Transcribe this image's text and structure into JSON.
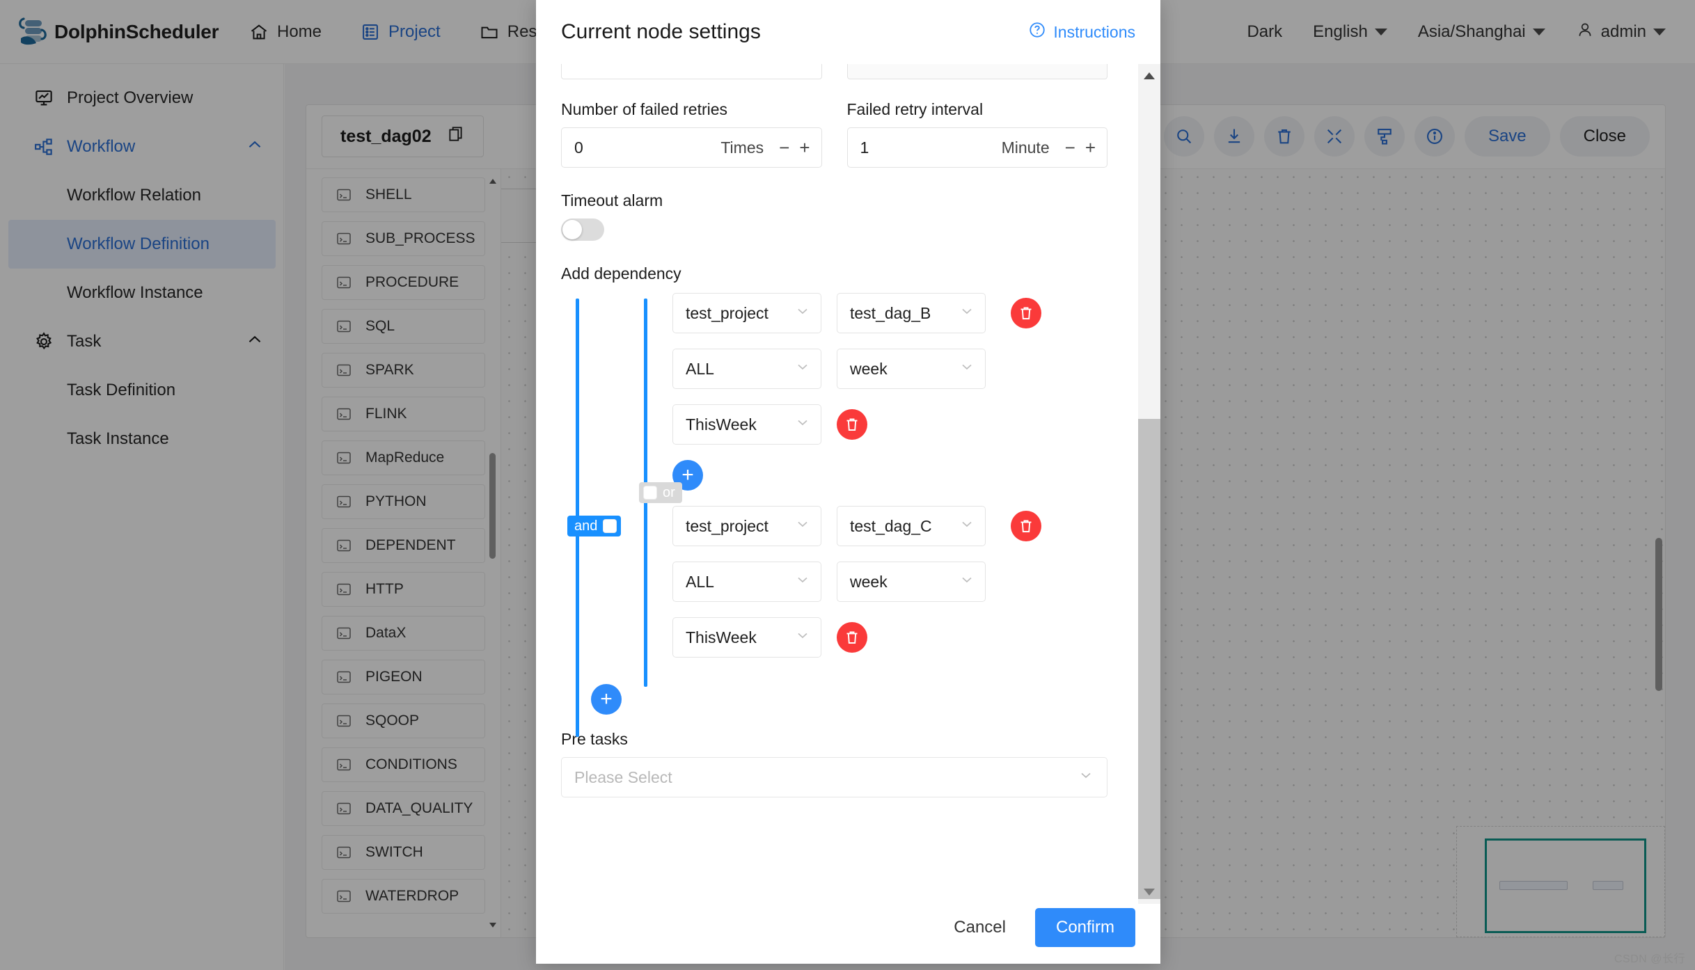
{
  "app": {
    "brand": "DolphinScheduler",
    "nav": [
      {
        "label": "Home",
        "icon": "home-icon",
        "active": false
      },
      {
        "label": "Project",
        "icon": "project-icon",
        "active": true
      },
      {
        "label": "Res",
        "icon": "folder-icon",
        "active": false
      }
    ],
    "top_right": {
      "theme": "Dark",
      "language": "English",
      "timezone": "Asia/Shanghai",
      "user": "admin"
    }
  },
  "sidebar": {
    "items": [
      {
        "label": "Project Overview",
        "icon": "overview-icon",
        "level": "group",
        "state": "normal"
      },
      {
        "label": "Workflow",
        "icon": "workflow-icon",
        "level": "group",
        "state": "expanded"
      },
      {
        "label": "Workflow Relation",
        "icon": "",
        "level": "sub",
        "state": "normal"
      },
      {
        "label": "Workflow Definition",
        "icon": "",
        "level": "sub",
        "state": "selected"
      },
      {
        "label": "Workflow Instance",
        "icon": "",
        "level": "sub",
        "state": "normal"
      },
      {
        "label": "Task",
        "icon": "gear-icon",
        "level": "group",
        "state": "expanded"
      },
      {
        "label": "Task Definition",
        "icon": "",
        "level": "sub",
        "state": "normal"
      },
      {
        "label": "Task Instance",
        "icon": "",
        "level": "sub",
        "state": "normal"
      }
    ]
  },
  "dag": {
    "name": "test_dag02",
    "copy_icon": "copy-icon",
    "toolbar": {
      "icons": [
        "search-icon",
        "download-icon",
        "trash-icon",
        "fullscreen-icon",
        "format-icon",
        "info-icon"
      ],
      "save_label": "Save",
      "close_label": "Close"
    },
    "palette": [
      {
        "label": "SHELL",
        "icon": "shell-icon"
      },
      {
        "label": "SUB_PROCESS",
        "icon": "sub-process-icon"
      },
      {
        "label": "PROCEDURE",
        "icon": "procedure-icon"
      },
      {
        "label": "SQL",
        "icon": "sql-icon"
      },
      {
        "label": "SPARK",
        "icon": "spark-icon"
      },
      {
        "label": "FLINK",
        "icon": "flink-icon"
      },
      {
        "label": "MapReduce",
        "icon": "mapreduce-icon"
      },
      {
        "label": "PYTHON",
        "icon": "python-icon"
      },
      {
        "label": "DEPENDENT",
        "icon": "dependent-icon"
      },
      {
        "label": "HTTP",
        "icon": "http-icon"
      },
      {
        "label": "DataX",
        "icon": "datax-icon"
      },
      {
        "label": "PIGEON",
        "icon": "pigeon-icon"
      },
      {
        "label": "SQOOP",
        "icon": "sqoop-icon"
      },
      {
        "label": "CONDITIONS",
        "icon": "conditions-icon"
      },
      {
        "label": "DATA_QUALITY",
        "icon": "data-quality-icon"
      },
      {
        "label": "SWITCH",
        "icon": "switch-icon"
      },
      {
        "label": "WATERDROP",
        "icon": "waterdrop-icon"
      }
    ]
  },
  "modal": {
    "title": "Current node settings",
    "instructions_label": "Instructions",
    "instructions_icon": "question-circle-icon",
    "fields": {
      "failed_retries_label": "Number of failed retries",
      "failed_retries_value": "0",
      "failed_retries_unit": "Times",
      "retry_interval_label": "Failed retry interval",
      "retry_interval_value": "1",
      "retry_interval_unit": "Minute",
      "timeout_alarm_label": "Timeout alarm",
      "timeout_alarm_state": "off",
      "add_dependency_label": "Add dependency",
      "pre_tasks_label": "Pre tasks",
      "pre_tasks_placeholder": "Please Select"
    },
    "dependency": {
      "and_badge": "and",
      "or_badge": "or",
      "groups": [
        {
          "selects": [
            [
              "test_project",
              "test_dag_B"
            ],
            [
              "ALL",
              "week"
            ],
            [
              "ThisWeek"
            ]
          ]
        },
        {
          "selects": [
            [
              "test_project",
              "test_dag_C"
            ],
            [
              "ALL",
              "week"
            ],
            [
              "ThisWeek"
            ]
          ]
        }
      ]
    },
    "footer": {
      "cancel_label": "Cancel",
      "confirm_label": "Confirm"
    }
  },
  "watermark": "CSDN @长行",
  "colors": {
    "primary": "#2f8bfa",
    "rail": "#1890ff",
    "danger": "#fa3a3a",
    "link": "#2a6ed4",
    "minimap_viewport": "#0f9488"
  }
}
